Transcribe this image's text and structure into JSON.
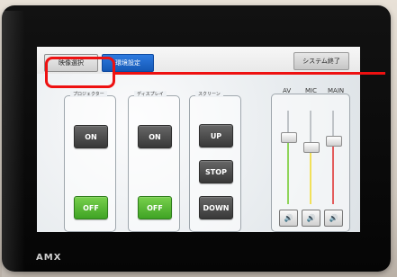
{
  "top_bar": {
    "tab_selected_label": "映像選択",
    "tab_blue_label": "環境設定",
    "shutdown_label": "システム終了"
  },
  "groups": [
    {
      "label": "プロジェクター",
      "buttons": [
        "ON",
        "OFF"
      ]
    },
    {
      "label": "ディスプレイ",
      "buttons": [
        "ON",
        "OFF"
      ]
    },
    {
      "label": "スクリーン",
      "buttons": [
        "UP",
        "STOP",
        "DOWN"
      ]
    }
  ],
  "audio": {
    "labels": [
      "AV",
      "MIC",
      "MAIN"
    ],
    "levels": [
      0.72,
      0.62,
      0.68
    ],
    "colors": [
      "#8fd45a",
      "#f1e05a",
      "#e35b5b"
    ],
    "icons": [
      "speaker-icon",
      "speaker-icon",
      "speaker-icon"
    ]
  },
  "branding": {
    "text": "AMX"
  },
  "annotation": {
    "highlight_color": "#e11"
  }
}
